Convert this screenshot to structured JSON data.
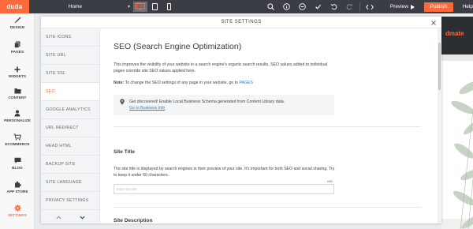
{
  "topbar": {
    "logo": "duda",
    "page_select": "Home",
    "preview_label": "Preview",
    "publish_label": "Publish",
    "help_label": "Help"
  },
  "leftnav": {
    "items": [
      {
        "label": "DESIGN",
        "icon": "brush-icon"
      },
      {
        "label": "PAGES",
        "icon": "pages-icon"
      },
      {
        "label": "WIDGETS",
        "icon": "plus-icon"
      },
      {
        "label": "CONTENT",
        "icon": "folder-icon"
      },
      {
        "label": "PERSONALIZE",
        "icon": "person-icon"
      },
      {
        "label": "ECOMMERCE",
        "icon": "cart-icon"
      },
      {
        "label": "BLOG",
        "icon": "chat-icon"
      },
      {
        "label": "APP STORE",
        "icon": "puzzle-icon"
      },
      {
        "label": "SETTINGS",
        "icon": "gear-icon",
        "active": true
      }
    ]
  },
  "panel": {
    "title": "SITE SETTINGS",
    "submenu": [
      "SITE ICONS",
      "SITE URL",
      "SITE SSL",
      "SEO",
      "GOOGLE ANALYTICS",
      "URL REDIRECT",
      "HEAD HTML",
      "BACKUP SITE",
      "SITE LANGUAGE",
      "PRIVACY SETTINGS"
    ],
    "active_submenu": "SEO",
    "content": {
      "heading": "SEO (Search Engine Optimization)",
      "intro": "This improves the visibility of your website in a search engine's organic search results. SEO values added to individual pages override site SEO values applied here.",
      "note_label": "Note:",
      "note_text": "To change the SEO settings of any page in your website, go to",
      "note_link": "PAGES",
      "info_text": "Get discovered! Enable Local Business Schema generated from Content Library data.",
      "info_link": "Go to Business Info",
      "site_title_heading": "Site Title",
      "site_title_desc": "The site title is displayed by search engines in their preview of your site. It's important for both SEO and social sharing. Try to keep it under 60 characters.",
      "site_title_counter": "0/80",
      "site_title_placeholder": "Enter site title",
      "site_title_value": "",
      "site_description_heading": "Site Description"
    }
  },
  "site_preview": {
    "brand_fragment": "dmate"
  },
  "colors": {
    "accent": "#ff6a3d",
    "topbar": "#3a3d43",
    "link": "#2a7fd4"
  }
}
